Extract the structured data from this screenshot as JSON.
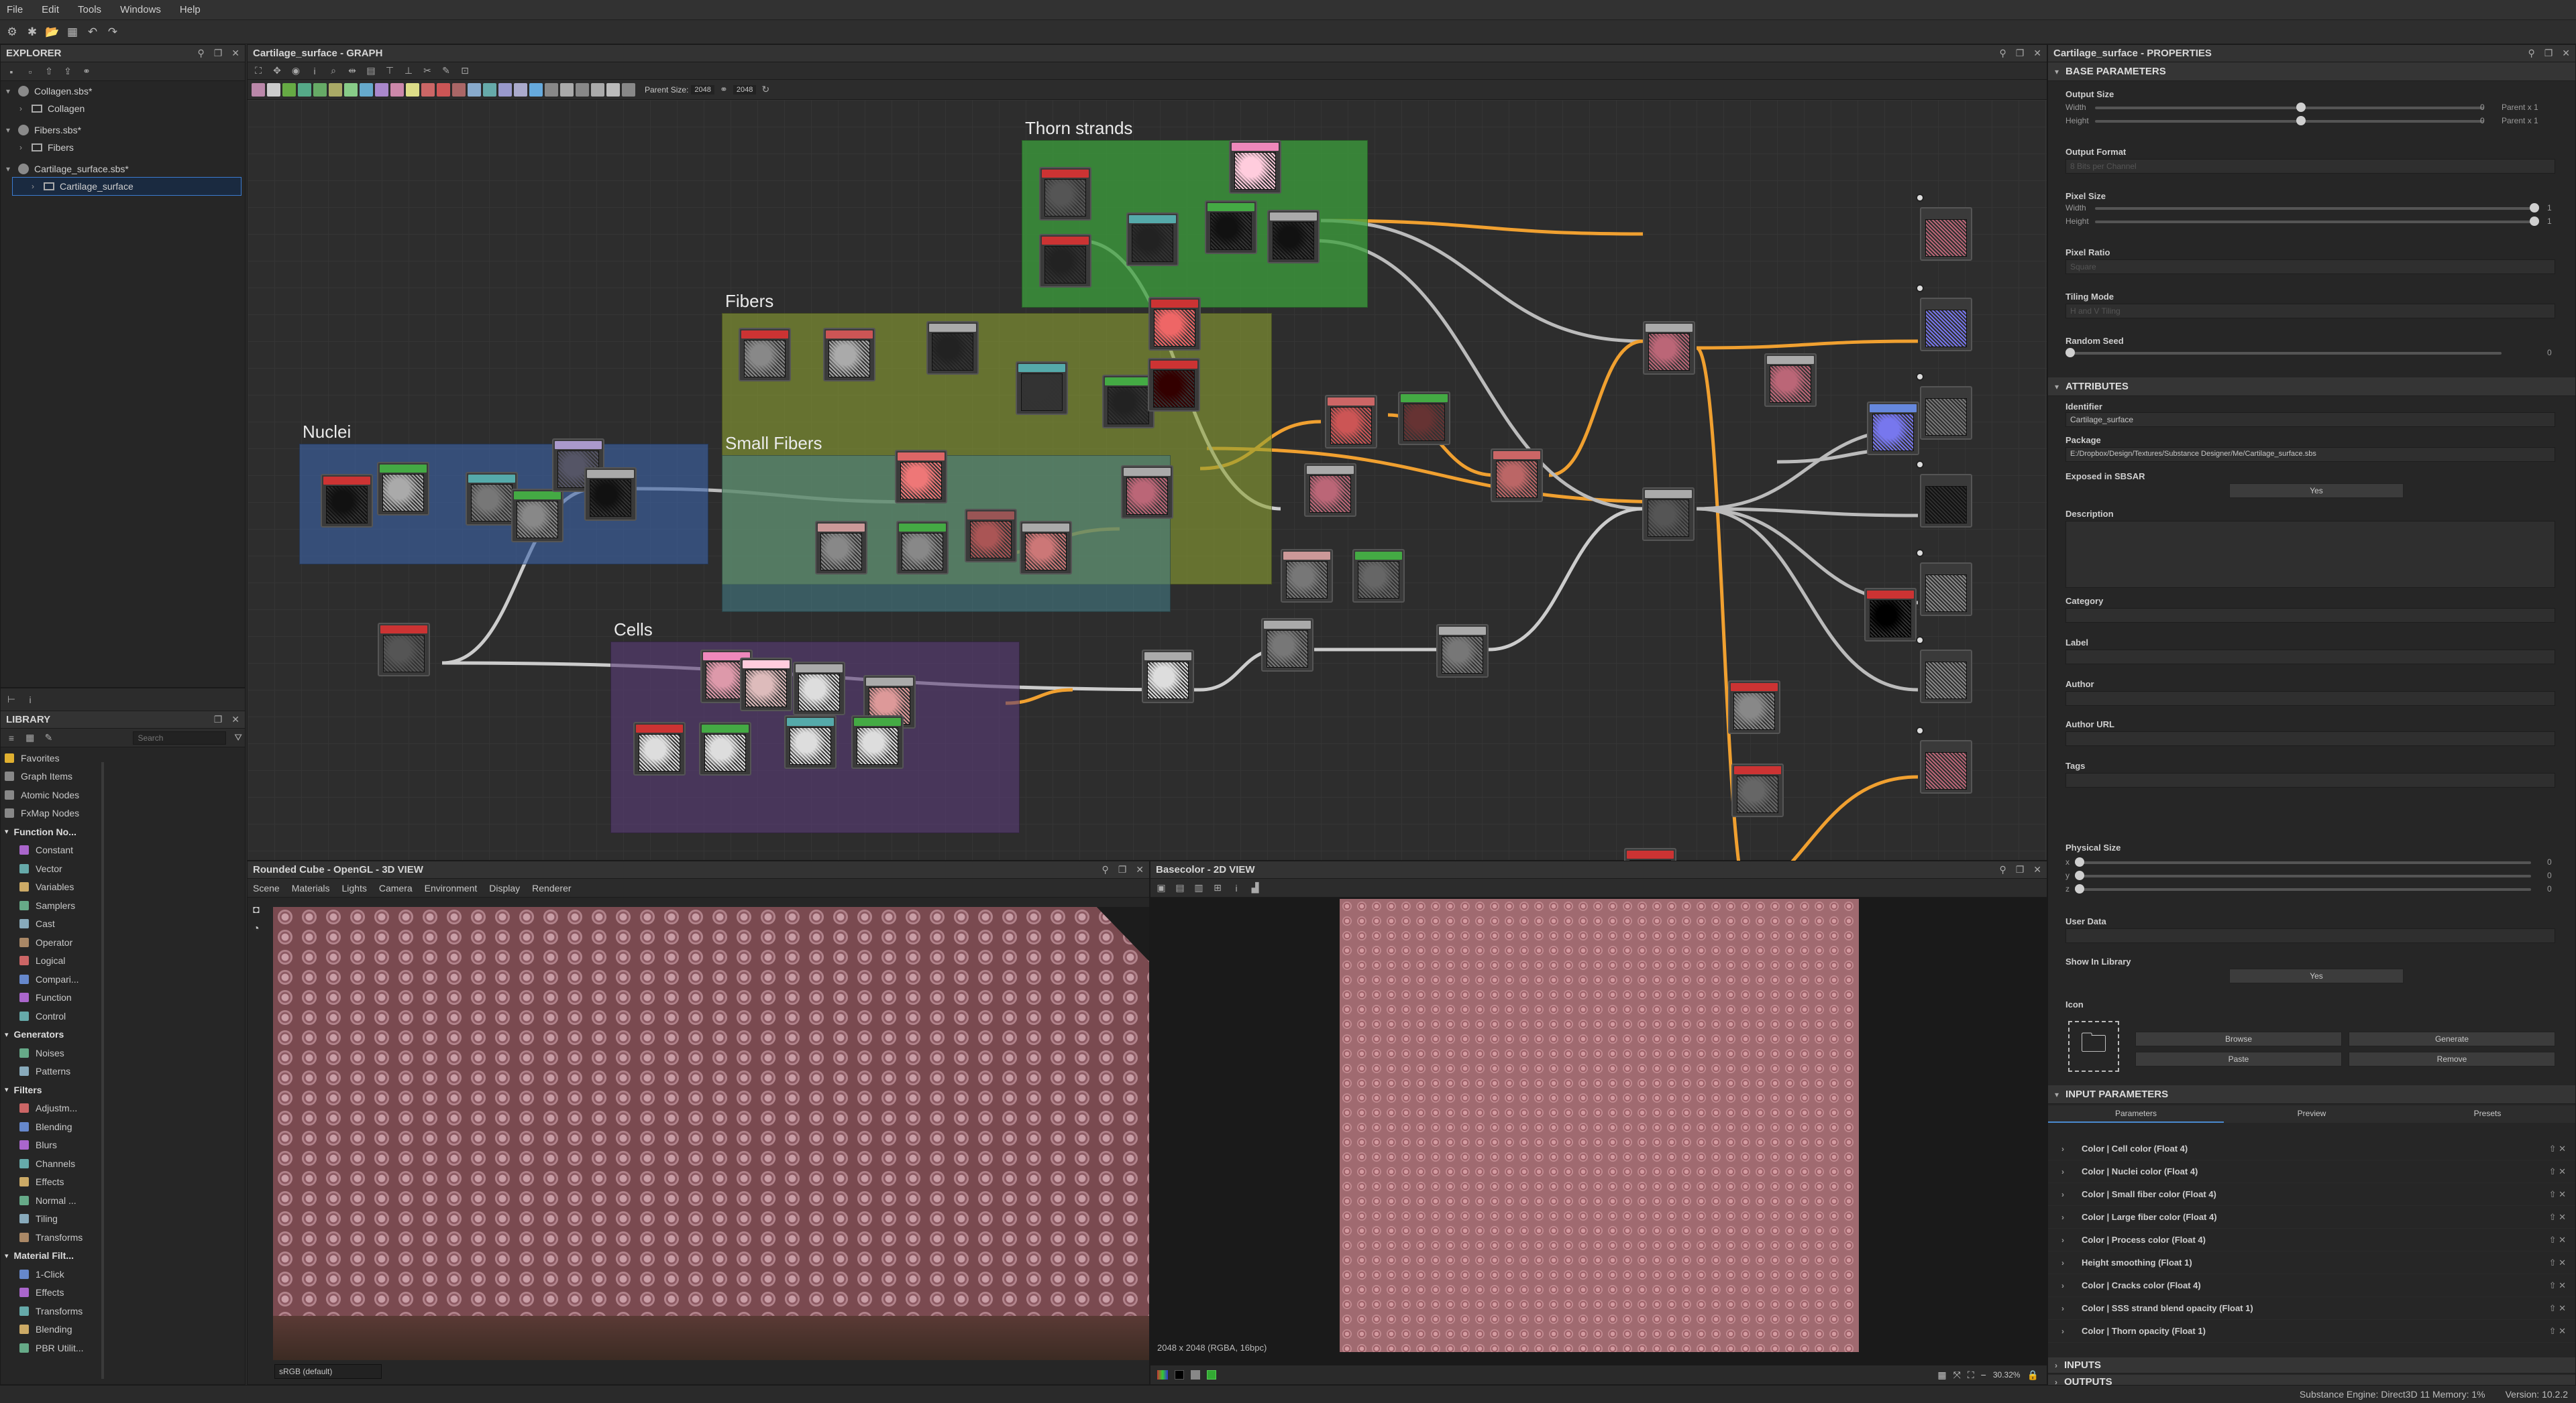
{
  "menu": [
    "File",
    "Edit",
    "Tools",
    "Windows",
    "Help"
  ],
  "explorer": {
    "title": "EXPLORER",
    "packages": [
      {
        "name": "Collagen.sbs*",
        "graph": "Collagen"
      },
      {
        "name": "Fibers.sbs*",
        "graph": "Fibers"
      },
      {
        "name": "Cartilage_surface.sbs*",
        "graph": "Cartilage_surface"
      }
    ]
  },
  "library": {
    "title": "LIBRARY",
    "search_placeholder": "Search",
    "categories": [
      "Favorites",
      "Graph Items",
      "Atomic Nodes",
      "FxMap Nodes",
      "Function No...",
      "Constant",
      "Vector",
      "Variables",
      "Samplers",
      "Cast",
      "Operator",
      "Logical",
      "Compari...",
      "Function",
      "Control",
      "Generators",
      "Noises",
      "Patterns",
      "Filters",
      "Adjustm...",
      "Blending",
      "Blurs",
      "Channels",
      "Effects",
      "Normal ...",
      "Tiling",
      "Transforms",
      "Material Filt...",
      "1-Click",
      "Effects",
      "Transforms",
      "Blending",
      "PBR Utilit..."
    ]
  },
  "graph": {
    "title": "Cartilage_surface - GRAPH",
    "parent_size_label": "Parent Size:",
    "parent_size": "2048",
    "size": "2048",
    "frames": [
      "Thorn strands",
      "Fibers",
      "Nuclei",
      "Small Fibers",
      "Cells"
    ]
  },
  "view3d": {
    "title": "Rounded Cube - OpenGL - 3D VIEW",
    "menu": [
      "Scene",
      "Materials",
      "Lights",
      "Camera",
      "Environment",
      "Display",
      "Renderer"
    ],
    "colorspace": "sRGB (default)"
  },
  "view2d": {
    "title": "Basecolor - 2D VIEW",
    "resolution": "2048 x 2048 (RGBA, 16bpc)",
    "zoom": "30.32%"
  },
  "properties": {
    "title": "Cartilage_surface - PROPERTIES",
    "base_header": "BASE PARAMETERS",
    "output_size": "Output Size",
    "width": "Width",
    "height": "Height",
    "zero": "0",
    "parent_x1": "Parent x 1",
    "output_format": "Output Format",
    "output_format_value": "8 Bits per Channel",
    "pixel_size": "Pixel Size",
    "one": "1",
    "pixel_ratio": "Pixel Ratio",
    "pixel_ratio_value": "Square",
    "tiling_mode": "Tiling Mode",
    "tiling_mode_value": "H and V Tiling",
    "random_seed": "Random Seed",
    "attr_header": "ATTRIBUTES",
    "identifier": "Identifier",
    "identifier_value": "Cartilage_surface",
    "package": "Package",
    "package_value": "E:/Dropbox/Design/Textures/Substance Designer/Me/Cartilage_surface.sbs",
    "exposed": "Exposed in SBSAR",
    "yes": "Yes",
    "description": "Description",
    "category": "Category",
    "label": "Label",
    "author": "Author",
    "author_url": "Author URL",
    "tags": "Tags",
    "physical_size": "Physical Size",
    "x": "x",
    "y": "y",
    "z": "z",
    "user_data": "User Data",
    "show_in_library": "Show In Library",
    "icon": "Icon",
    "browse": "Browse",
    "generate": "Generate",
    "paste": "Paste",
    "remove": "Remove",
    "input_header": "INPUT PARAMETERS",
    "tabs": [
      "Parameters",
      "Preview",
      "Presets"
    ],
    "inputs": [
      "Color | Cell color (Float 4)",
      "Color | Nuclei color (Float 4)",
      "Color | Small fiber color (Float 4)",
      "Color | Large fiber color (Float 4)",
      "Color | Process color (Float 4)",
      "Height smoothing (Float 1)",
      "Color | Cracks color (Float 4)",
      "Color | SSS strand blend opacity (Float 1)",
      "Color | Thorn opacity (Float 1)"
    ],
    "inputs_header": "INPUTS",
    "outputs_header": "OUTPUTS"
  },
  "status": {
    "engine": "Substance Engine: Direct3D 11  Memory: 1%",
    "version": "Version: 10.2.2"
  }
}
